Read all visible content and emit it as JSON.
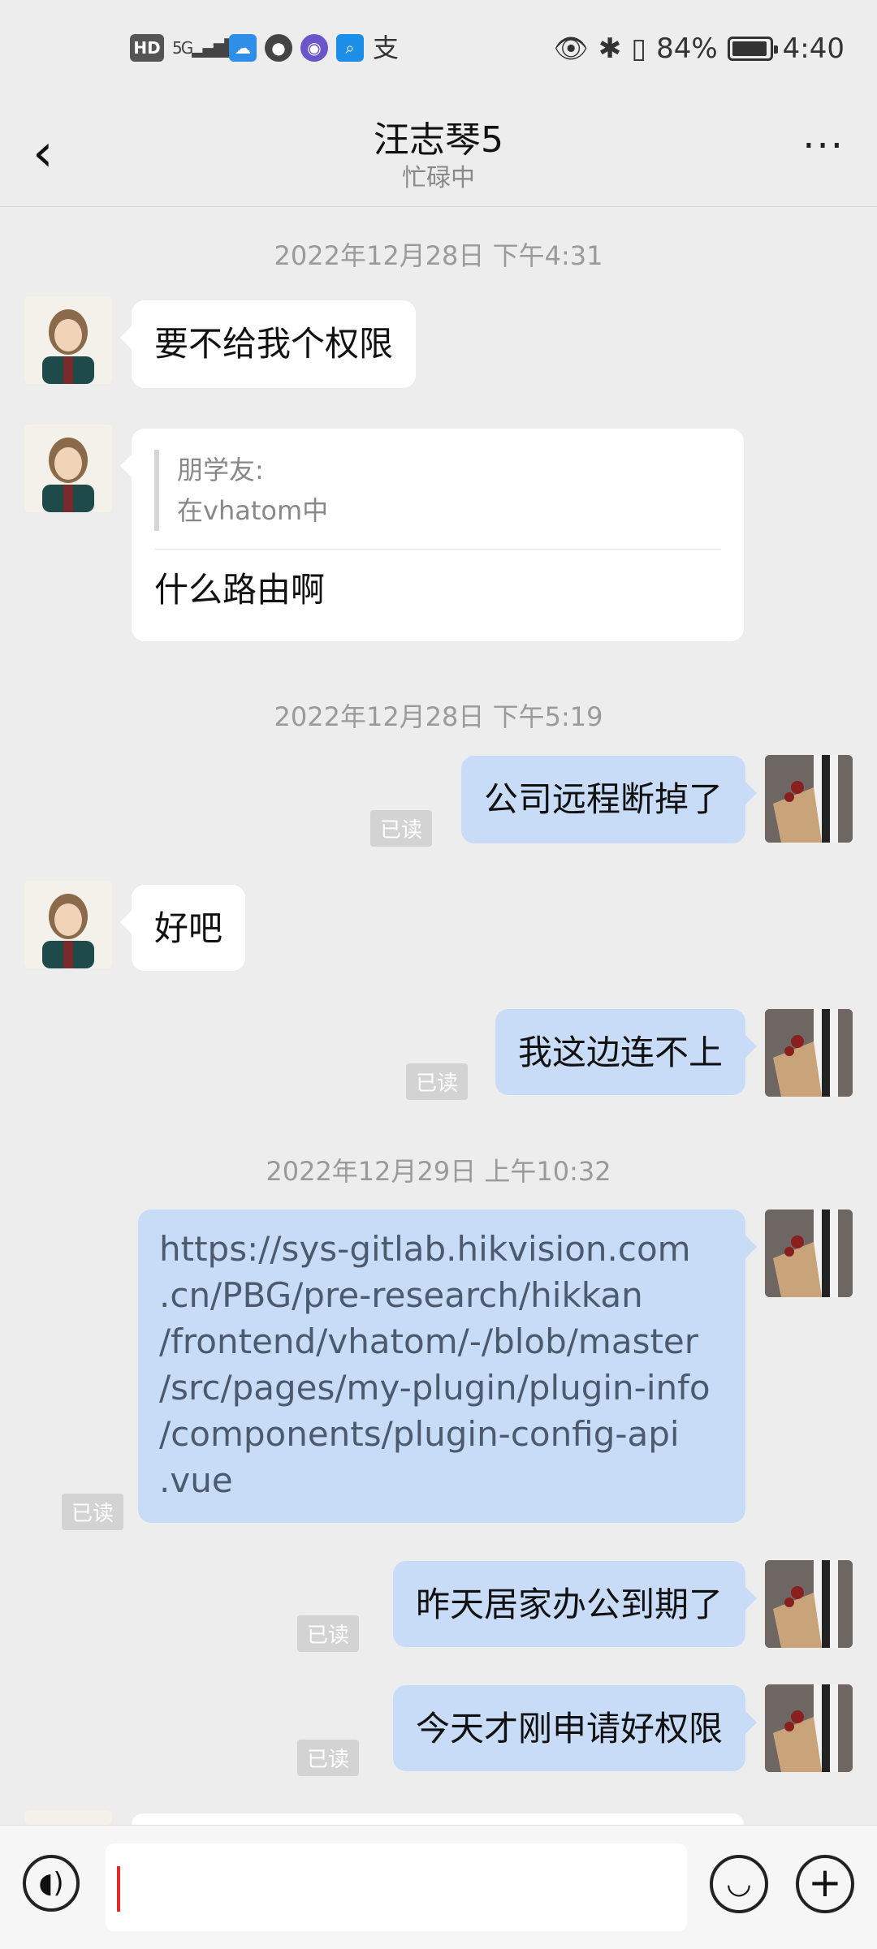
{
  "status_bar": {
    "left_icons": [
      "hd-icon",
      "5g-signal-icon",
      "weather-app-icon",
      "message-app-icon",
      "purple-app-icon",
      "search-app-icon",
      "alipay-icon"
    ],
    "battery_percent": "84%",
    "time": "4:40"
  },
  "header": {
    "title": "汪志琴5",
    "status": "忙碌中"
  },
  "messages": {
    "ts1": "2022年12月28日 下午4:31",
    "m1": "要不给我个权限",
    "m2_quote_name": "朋学友:",
    "m2_quote_text": "在vhatom中",
    "m2_text": "什么路由啊",
    "ts2": "2022年12月28日 下午5:19",
    "m3": "公司远程断掉了",
    "m4": "好吧",
    "m5": "我这边连不上",
    "ts3": "2022年12月29日 上午10:32",
    "m6_lines": [
      "https://sys-gitlab.hikvision.com",
      ".cn/PBG/pre-research/hikkan",
      "/frontend/vhatom/-/blob/master",
      "/src/pages/my-plugin/plugin-info",
      "/components/plugin-config-api",
      ".vue"
    ],
    "m7": "昨天居家办公到期了",
    "m8": "今天才刚申请好权限",
    "read_label": "已读"
  },
  "input_bar": {
    "voice_icon": "voice-icon",
    "emoji_icon": "emoji-icon",
    "plus_icon": "plus-icon"
  }
}
